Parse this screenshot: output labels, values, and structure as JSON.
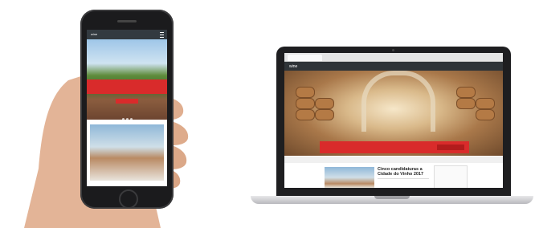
{
  "phone": {
    "logo_text": "wine",
    "banner_text": "",
    "button_label": ""
  },
  "laptop": {
    "browser_tab": "",
    "logo_text": "wine",
    "menu_items": [
      "",
      "",
      "",
      "",
      "",
      ""
    ],
    "banner_text": "",
    "banner_button": "",
    "news_title": "Cinco candidaturas a Cidade do Vinho 2017"
  },
  "colors": {
    "accent_red": "#d92b2b",
    "nav_dark": "#2f3438",
    "device_black": "#1b1b1d"
  }
}
